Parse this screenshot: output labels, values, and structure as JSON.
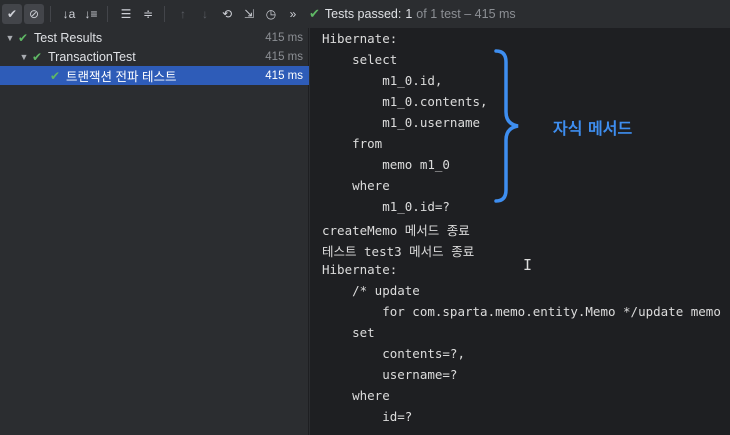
{
  "toolbar": {
    "icons": [
      "check-icon",
      "stop-icon",
      "sort-alpha-icon",
      "sort-duration-icon",
      "expand-all-icon",
      "collapse-all-icon",
      "arrow-up-icon",
      "arrow-down-icon",
      "rerun-icon",
      "import-icon",
      "history-icon",
      "more-icon"
    ],
    "status_check": "✔",
    "status_label": "Tests passed:",
    "status_count": "1",
    "status_rest": "of 1 test – 415 ms"
  },
  "tree": {
    "rows": [
      {
        "label": "Test Results",
        "time": "415 ms"
      },
      {
        "label": "TransactionTest",
        "time": "415 ms"
      },
      {
        "label": "트랜잭션 전파 테스트",
        "time": "415 ms"
      }
    ]
  },
  "console": {
    "lines": [
      "Hibernate:",
      "    select",
      "        m1_0.id,",
      "        m1_0.contents,",
      "        m1_0.username",
      "    from",
      "        memo m1_0",
      "    where",
      "        m1_0.id=?",
      "createMemo 메서드 종료",
      "테스트 test3 메서드 종료",
      "Hibernate:",
      "    /* update",
      "        for com.sparta.memo.entity.Memo */update memo",
      "    set",
      "        contents=?,",
      "        username=?",
      "    where",
      "        id=?"
    ]
  },
  "annotation": {
    "label": "자식 메서드",
    "color": "#3e8ef0"
  }
}
